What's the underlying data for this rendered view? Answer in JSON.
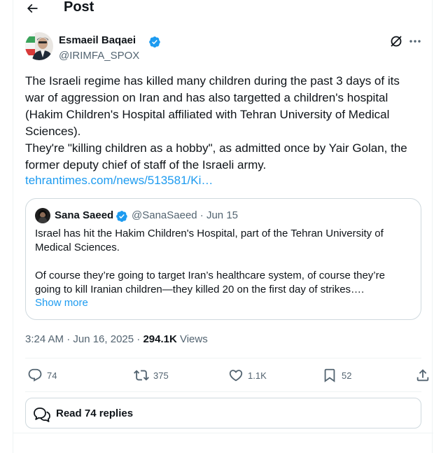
{
  "header": {
    "title": "Post",
    "back_icon": "arrow-left-icon"
  },
  "author": {
    "name": "Esmaeil Baqaei",
    "handle": "@IRIMFA_SPOX",
    "verified": true
  },
  "tweet": {
    "lines": [
      "The Israeli regime has killed many children during the past 3 days of its",
      "war of aggression on Iran and has also targetted a children's hospital",
      "(Hakim Children's Hospital affiliated with Tehran University of Medical",
      "Sciences).",
      "They're \"killing children as a hobby\", as admitted once by Yair Golan, the",
      "former deputy chief of staff of the Israeli army."
    ],
    "link": "tehrantimes.com/news/513581/Ki…"
  },
  "quote": {
    "name": "Sana Saeed",
    "handle_date": "@SanaSaeed · Jun 15",
    "paragraph1": "Israel has hit the Hakim Children's Hospital, part of the Tehran University of Medical Sciences.",
    "paragraph2": "Of course they’re going to target Iran’s healthcare system, of course they’re going to kill Iranian children—they killed 20 on the first day of strikes….",
    "show_more": "Show more"
  },
  "meta": {
    "time_date": "3:24 AM · Jun 16, 2025 · ",
    "views_count": "294.1K",
    "views_label": " Views"
  },
  "actions": {
    "replies": "74",
    "reposts": "375",
    "likes": "1.1K",
    "bookmarks": "52"
  },
  "read_replies": {
    "label": "Read 74 replies"
  },
  "colors": {
    "accent": "#1d9bf0",
    "secondary_text": "#536471",
    "border": "#cfd9de",
    "verified": "#1d9bf0"
  }
}
